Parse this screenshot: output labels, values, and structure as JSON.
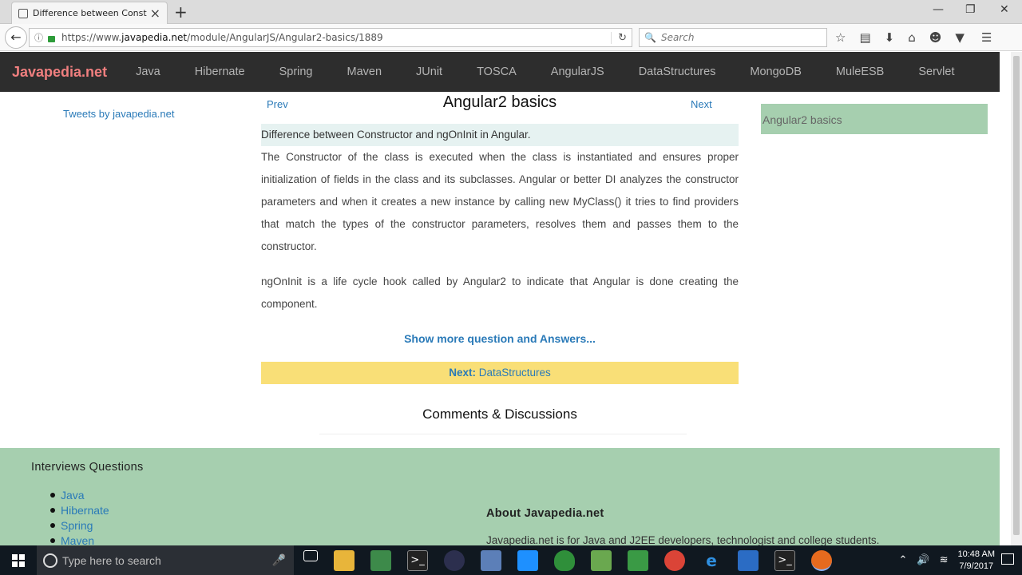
{
  "browser": {
    "tab_title": "Difference between Const...",
    "url_prefix": "https://www.",
    "url_domain": "javapedia.net",
    "url_path": "/module/AngularJS/Angular2-basics/1889",
    "search_placeholder": "Search"
  },
  "site": {
    "brand": "Javapedia.net",
    "menu": [
      "Java",
      "Hibernate",
      "Spring",
      "Maven",
      "JUnit",
      "TOSCA",
      "AngularJS",
      "DataStructures",
      "MongoDB",
      "MuleESB",
      "Servlet"
    ]
  },
  "page": {
    "tweets_link": "Tweets by javapedia.net",
    "prev": "Prev",
    "next": "Next",
    "title": "Angular2 basics",
    "question": "Difference between Constructor and ngOnInit in Angular.",
    "answer_p1": "The Constructor of the class is executed when the class is instantiated and ensures proper initialization of fields in the class and its subclasses. Angular or better DI analyzes the constructor parameters and when it creates a new instance by calling new MyClass() it tries to find providers that match the types of the constructor parameters, resolves them and passes them to the constructor.",
    "answer_p2": "ngOnInit is a life cycle hook called by Angular2 to indicate that Angular is done creating the component.",
    "show_more": "Show more question and Answers...",
    "next_label": "Next:",
    "next_topic": "DataStructures",
    "comments_heading": "Comments & Discussions",
    "sidebar_item": "Angular2 basics"
  },
  "footer": {
    "interviews_heading": "Interviews Questions",
    "interview_links": [
      "Java",
      "Hibernate",
      "Spring",
      "Maven"
    ],
    "about_heading": "About Javapedia.net",
    "about_text": "Javapedia.net is for Java and J2EE developers, technologist and college students."
  },
  "taskbar": {
    "search_placeholder": "Type here to search",
    "time": "10:48 AM",
    "date": "7/9/2017"
  }
}
